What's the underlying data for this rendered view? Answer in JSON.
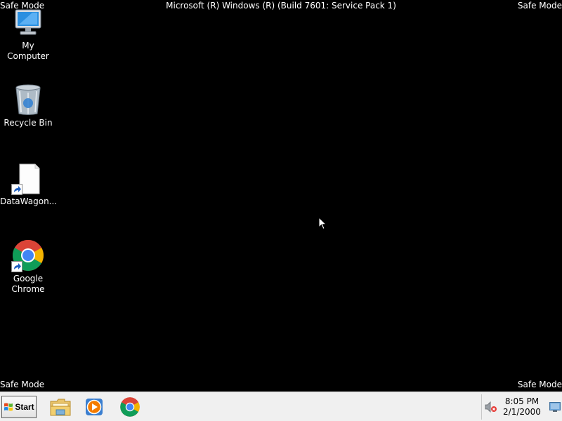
{
  "screen": {
    "title": "Microsoft (R) Windows (R) (Build 7601: Service Pack 1)",
    "safe_mode_label": "Safe Mode"
  },
  "desktop_icons": [
    {
      "label": "My Computer",
      "icon": "computer-icon"
    },
    {
      "label": "Recycle Bin",
      "icon": "recycle-bin-icon"
    },
    {
      "label": "DataWagon...",
      "icon": "document-shortcut-icon"
    },
    {
      "label": "Google Chrome",
      "icon": "chrome-icon"
    }
  ],
  "taskbar": {
    "start_label": "Start",
    "pinned": [
      {
        "name": "Windows Explorer",
        "icon": "explorer-folder-icon"
      },
      {
        "name": "Windows Media Player",
        "icon": "media-player-icon"
      },
      {
        "name": "Google Chrome",
        "icon": "chrome-icon"
      }
    ],
    "tray": {
      "volume_icon": "volume-muted-icon",
      "time": "8:05 PM",
      "date": "2/1/2000",
      "show_desktop_icon": "show-desktop-icon"
    }
  },
  "colors": {
    "desktop_bg": "#000000",
    "taskbar_bg": "#f0f0f0",
    "text_on_desktop": "#ffffff"
  }
}
